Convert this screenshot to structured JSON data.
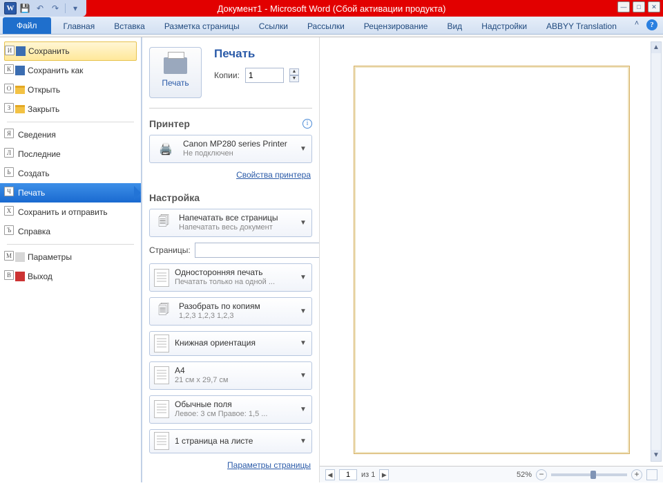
{
  "title": "Документ1 - Microsoft Word (Сбой активации продукта)",
  "ribbon": {
    "file": "Файл",
    "tabs": [
      "Главная",
      "Вставка",
      "Разметка страницы",
      "Ссылки",
      "Рассылки",
      "Рецензирование",
      "Вид",
      "Надстройки",
      "ABBYY Translation"
    ]
  },
  "side": {
    "save": "Сохранить",
    "save_k": "И",
    "saveas": "Сохранить как",
    "saveas_k": "К",
    "open": "Открыть",
    "open_k": "О",
    "close": "Закрыть",
    "close_k": "З",
    "info": "Сведения",
    "info_k": "Я",
    "recent": "Последние",
    "recent_k": "Л",
    "new": "Создать",
    "new_k": "Ь",
    "print": "Печать",
    "print_k": "Ч",
    "sharesend": "Сохранить и отправить",
    "sharesend_k": "Х",
    "help": "Справка",
    "help_k": "Ъ",
    "options": "Параметры",
    "options_k": "М",
    "exit": "Выход",
    "exit_k": "В"
  },
  "print": {
    "heading": "Печать",
    "button": "Печать",
    "copies_label": "Копии:",
    "copies_value": "1",
    "printer_section": "Принтер",
    "printer_name": "Canon MP280 series Printer",
    "printer_status": "Не подключен",
    "printer_props": "Свойства принтера",
    "settings_section": "Настройка",
    "scope_title": "Напечатать все страницы",
    "scope_sub": "Напечатать весь документ",
    "pages_label": "Страницы:",
    "duplex_title": "Односторонняя печать",
    "duplex_sub": "Печатать только на одной ...",
    "collate_title": "Разобрать по копиям",
    "collate_sub": "1,2,3   1,2,3   1,2,3",
    "orient_title": "Книжная ориентация",
    "size_title": "A4",
    "size_sub": "21 см x 29,7 см",
    "margins_title": "Обычные поля",
    "margins_sub": "Левое:  3 см   Правое:  1,5 ...",
    "ppsheet_title": "1 страница на листе",
    "page_setup": "Параметры страницы"
  },
  "preview": {
    "page_current": "1",
    "page_of": "из 1",
    "zoom": "52%"
  }
}
